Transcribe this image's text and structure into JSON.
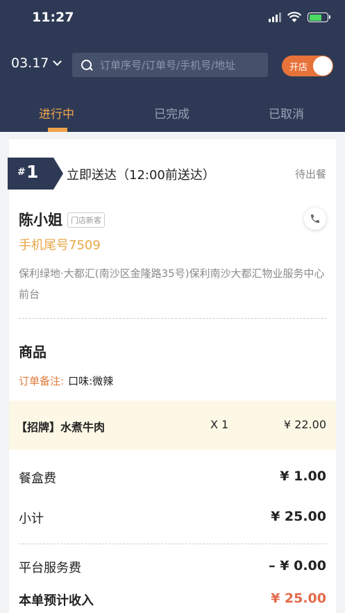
{
  "status_bar": {
    "time": "11:27"
  },
  "toolbar": {
    "date": "03.17",
    "search_placeholder": "订单序号/订单号/手机号/地址",
    "store_toggle_label": "开店"
  },
  "tabs": [
    {
      "label": "进行中",
      "active": true
    },
    {
      "label": "已完成",
      "active": false
    },
    {
      "label": "已取消",
      "active": false
    }
  ],
  "order": {
    "hash": "#",
    "number": "1",
    "delivery": "立即送达（12:00前送达）",
    "status": "待出餐",
    "customer": {
      "name": "陈小姐",
      "tag": "门店新客",
      "phone_tail": "手机尾号7509",
      "address": "保利绿地·大都汇(南沙区金隆路35号)保利南沙大都汇物业服务中心前台"
    },
    "goods_title": "商品",
    "remark_label": "订单备注:",
    "remark_value": "口味:微辣",
    "items": [
      {
        "name": "【招牌】水煮牛肉",
        "qty": "X 1",
        "price": "¥ 22.00"
      }
    ],
    "fees": {
      "box_label": "餐盒费",
      "box_value": "¥ 1.00",
      "subtotal_label": "小计",
      "subtotal_value": "¥ 25.00",
      "service_label": "平台服务费",
      "service_value": "– ¥ 0.00",
      "income_label": "本单预计收入",
      "income_value": "¥ 25.00"
    }
  },
  "colors": {
    "header_bg": "#2e3a55",
    "accent_orange": "#f0a34a",
    "toggle_bg": "#e8733a",
    "badge_bg": "#2e3a55",
    "income_red": "#e46a4a"
  }
}
